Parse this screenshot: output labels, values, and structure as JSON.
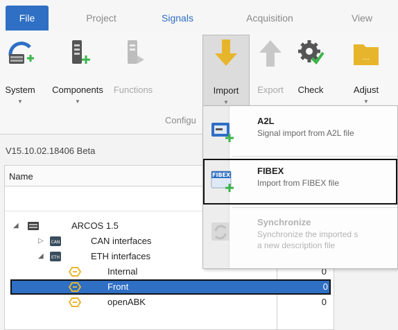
{
  "tabs": [
    "File",
    "Project",
    "Signals",
    "Acquisition",
    "View"
  ],
  "ribbon": {
    "buttons": [
      {
        "label": "System",
        "icon": "system-icon",
        "enabled": true
      },
      {
        "label": "Components",
        "icon": "components-icon",
        "enabled": true
      },
      {
        "label": "Functions",
        "icon": "functions-icon",
        "enabled": false
      },
      {
        "label": "Import",
        "icon": "import-arrow-icon",
        "enabled": true,
        "pressed": true
      },
      {
        "label": "Export",
        "icon": "export-arrow-icon",
        "enabled": false
      },
      {
        "label": "Check",
        "icon": "check-gear-icon",
        "enabled": true
      },
      {
        "label": "Adjust",
        "icon": "adjust-folder-icon",
        "enabled": true
      }
    ],
    "group_label": "Configu"
  },
  "panel": {
    "version": "V15.10.02.18406 Beta",
    "column_name": "Name"
  },
  "tree": [
    {
      "label": "ARCOS 1.5",
      "icon": "device-icon",
      "expander": "◢",
      "value": ""
    },
    {
      "label": "CAN interfaces",
      "icon": "can-icon",
      "expander": "▷",
      "value": ""
    },
    {
      "label": "ETH interfaces",
      "icon": "eth-icon",
      "expander": "◢",
      "value": ""
    },
    {
      "label": "Internal",
      "icon": "port-icon",
      "expander": "",
      "value": "0"
    },
    {
      "label": "Front",
      "icon": "port-icon",
      "expander": "",
      "value": "0",
      "selected": true
    },
    {
      "label": "openABK",
      "icon": "port-icon",
      "expander": "",
      "value": "0"
    }
  ],
  "dropdown": {
    "items": [
      {
        "title": "A2L",
        "desc": "Signal import from A2L file",
        "desc2": "",
        "icon": "a2l-file-icon"
      },
      {
        "title": "FIBEX",
        "desc": "Import from FIBEX file",
        "desc2": "",
        "icon": "fibex-file-icon",
        "badge": "FIBEX"
      },
      {
        "title": "Synchronize",
        "desc": "Synchronize the imported s",
        "desc2": "a new description file",
        "icon": "synchronize-icon"
      }
    ]
  },
  "colors": {
    "accent": "#2f6fc4",
    "import_arrow": "#e7b52c",
    "plus_green": "#3bb54a"
  }
}
